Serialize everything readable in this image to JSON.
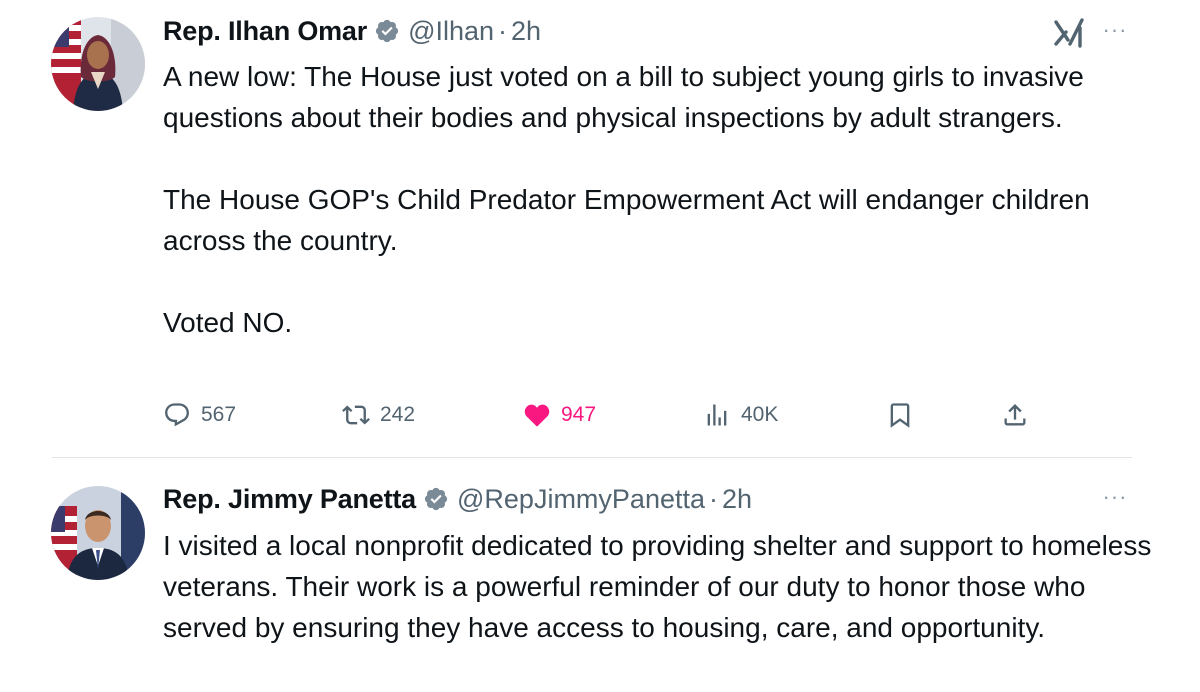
{
  "tweets": [
    {
      "name": "Rep. Ilhan Omar",
      "handle": "@Ilhan",
      "separator": "·",
      "time": "2h",
      "text": "A new low: The House just voted on a bill to subject young girls to invasive questions about their bodies and physical inspections by adult strangers.\n\nThe House GOP's Child Predator Empowerment Act will endanger children across the country.\n\nVoted NO.",
      "stats": {
        "replies": "567",
        "retweets": "242",
        "likes": "947",
        "views": "40K"
      },
      "liked": true
    },
    {
      "name": "Rep. Jimmy Panetta",
      "handle": "@RepJimmyPanetta",
      "separator": "·",
      "time": "2h",
      "text": "I visited a local nonprofit dedicated to providing shelter and support to homeless veterans. Their work is a powerful reminder of our duty to honor those who served by ensuring they have access to housing, care, and opportunity."
    }
  ],
  "icons": {
    "verified": "verified-badge-icon",
    "grok": "grok-icon",
    "more": "more-options-icon",
    "reply": "reply-icon",
    "retweet": "retweet-icon",
    "like": "heart-icon",
    "views": "views-icon",
    "bookmark": "bookmark-icon",
    "share": "share-icon"
  },
  "colors": {
    "text_primary": "#0f1419",
    "text_secondary": "#536471",
    "verified_fill": "#7b8a97",
    "like": "#f91880",
    "divider": "#e1e6ea"
  }
}
